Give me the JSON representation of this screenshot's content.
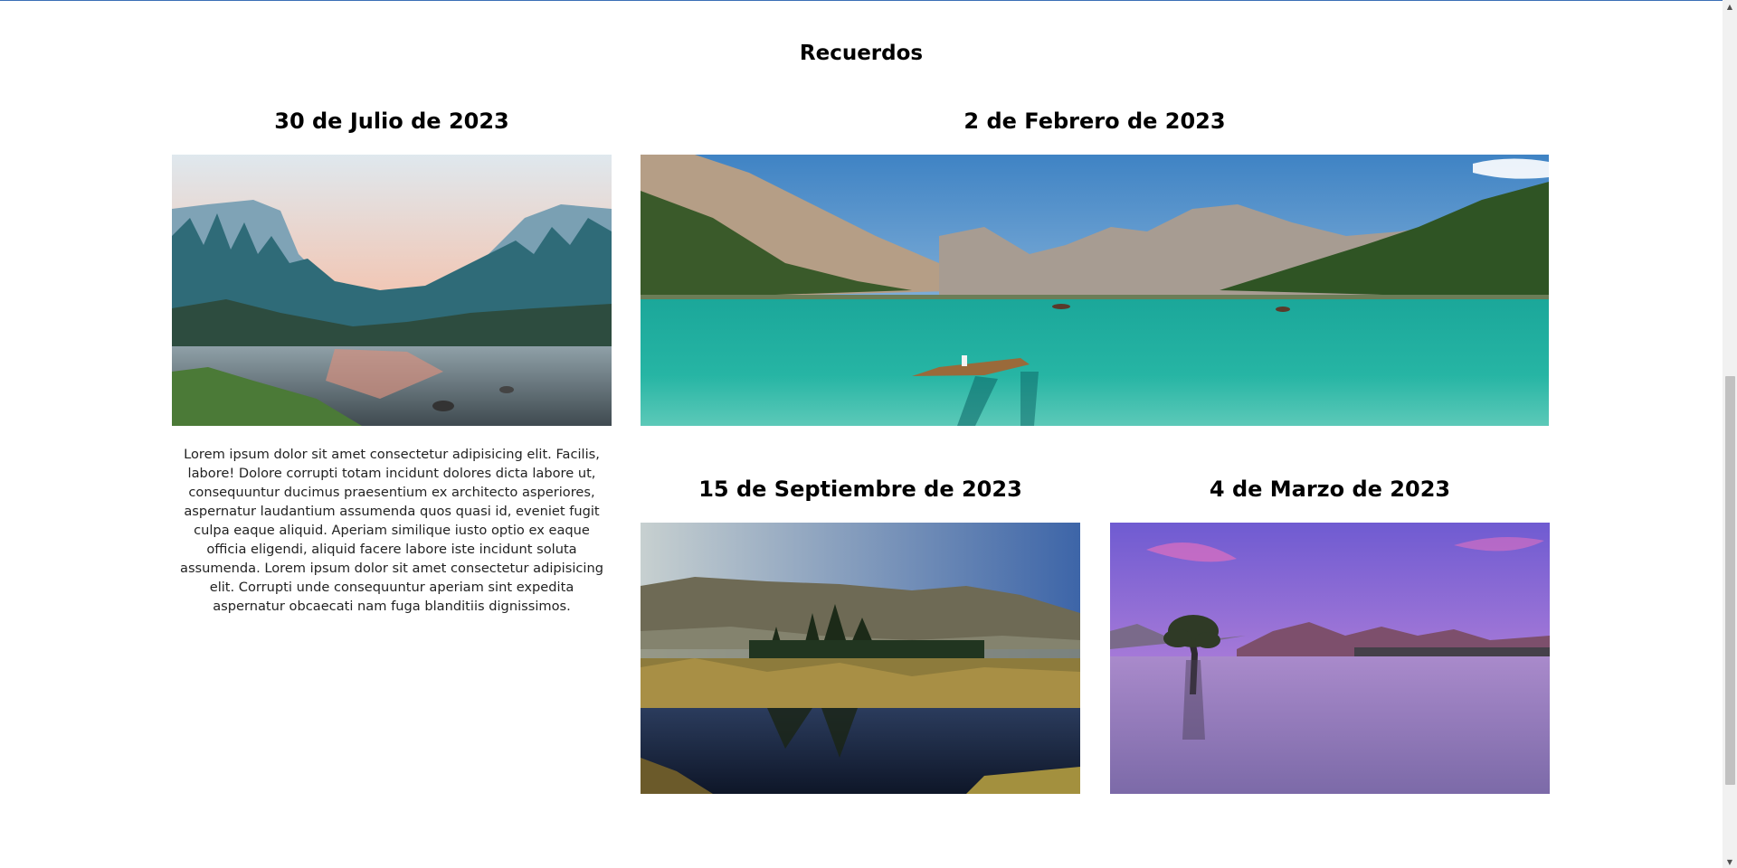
{
  "page": {
    "title": "Recuerdos"
  },
  "cards": [
    {
      "date": "30 de Julio de 2023",
      "image": "forest-valley-sunset-photo"
    },
    {
      "date": "2 de Febrero de 2023",
      "image": "mountain-lake-boat-photo"
    },
    {
      "date": "15 de Septiembre de 2023",
      "image": "meadow-lake-reflection-photo"
    },
    {
      "date": "4 de Marzo de 2023",
      "image": "lone-tree-lake-dusk-photo"
    }
  ],
  "description": "Lorem ipsum dolor sit amet consectetur adipisicing elit. Facilis, labore! Dolore corrupti totam incidunt dolores dicta labore ut, consequuntur ducimus praesentium ex architecto asperiores, aspernatur laudantium assumenda quos quasi id, eveniet fugit culpa eaque aliquid. Aperiam similique iusto optio ex eaque officia eligendi, aliquid facere labore iste incidunt soluta assumenda. Lorem ipsum dolor sit amet consectetur adipisicing elit. Corrupti unde consequuntur aperiam sint expedita aspernatur obcaecati nam fuga blanditiis dignissimos.",
  "scrollbar": {
    "up_icon": "scroll-up-arrow",
    "down_icon": "scroll-down-arrow"
  }
}
